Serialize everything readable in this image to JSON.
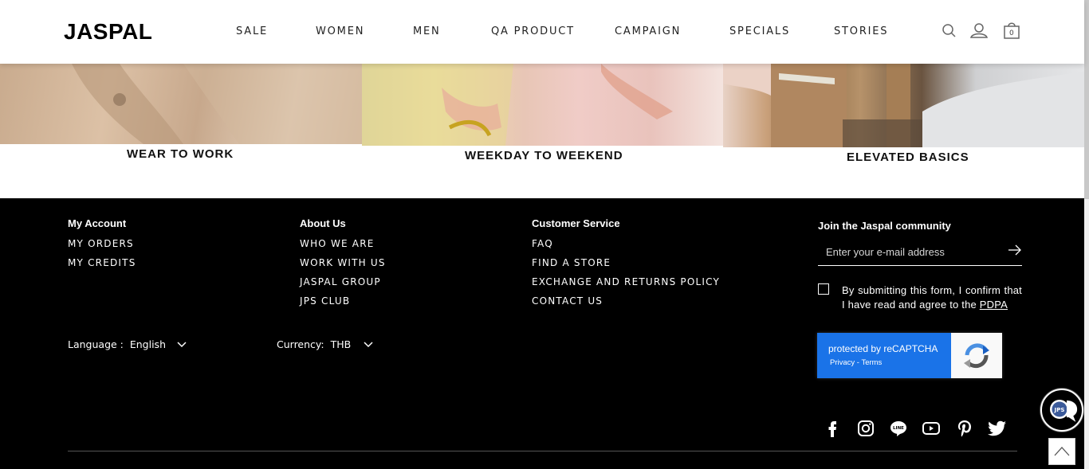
{
  "header": {
    "logo": "JASPAL",
    "nav": [
      "SALE",
      "WOMEN",
      "MEN",
      "QA PRODUCT",
      "CAMPAIGN",
      "SPECIALS",
      "STORIES"
    ],
    "cart_count": "0",
    "icons": [
      "search-icon",
      "user-icon",
      "shopping-bag-icon"
    ]
  },
  "promos": [
    {
      "caption": "WEAR TO WORK"
    },
    {
      "caption": "WEEKDAY TO WEEKEND"
    },
    {
      "caption": "ELEVATED BASICS"
    }
  ],
  "footer": {
    "account": {
      "title": "My Account",
      "links": [
        "MY ORDERS",
        "MY CREDITS"
      ]
    },
    "about": {
      "title": "About Us",
      "links": [
        "WHO WE ARE",
        "WORK WITH US",
        "JASPAL GROUP",
        "JPS CLUB"
      ]
    },
    "service": {
      "title": "Customer Service",
      "links": [
        "FAQ",
        "FIND A STORE",
        "EXCHANGE AND RETURNS POLICY",
        "CONTACT US"
      ]
    },
    "language": {
      "label": "Language :",
      "value": "English"
    },
    "currency": {
      "label": "Currency:",
      "value": "THB"
    },
    "community": {
      "title": "Join the Jaspal community",
      "email_placeholder": "Enter your e-mail address",
      "consent_text": "By submitting this form, I confirm that I have read and agree to the",
      "consent_link": "PDPA"
    },
    "recaptcha": {
      "text": "protected by reCAPTCHA",
      "privacy": "Privacy",
      "separator": " - ",
      "terms": "Terms"
    },
    "social": [
      "facebook-icon",
      "instagram-icon",
      "line-icon",
      "youtube-icon",
      "pinterest-icon",
      "twitter-icon"
    ]
  },
  "floating": {
    "chat_label": "JPS"
  }
}
